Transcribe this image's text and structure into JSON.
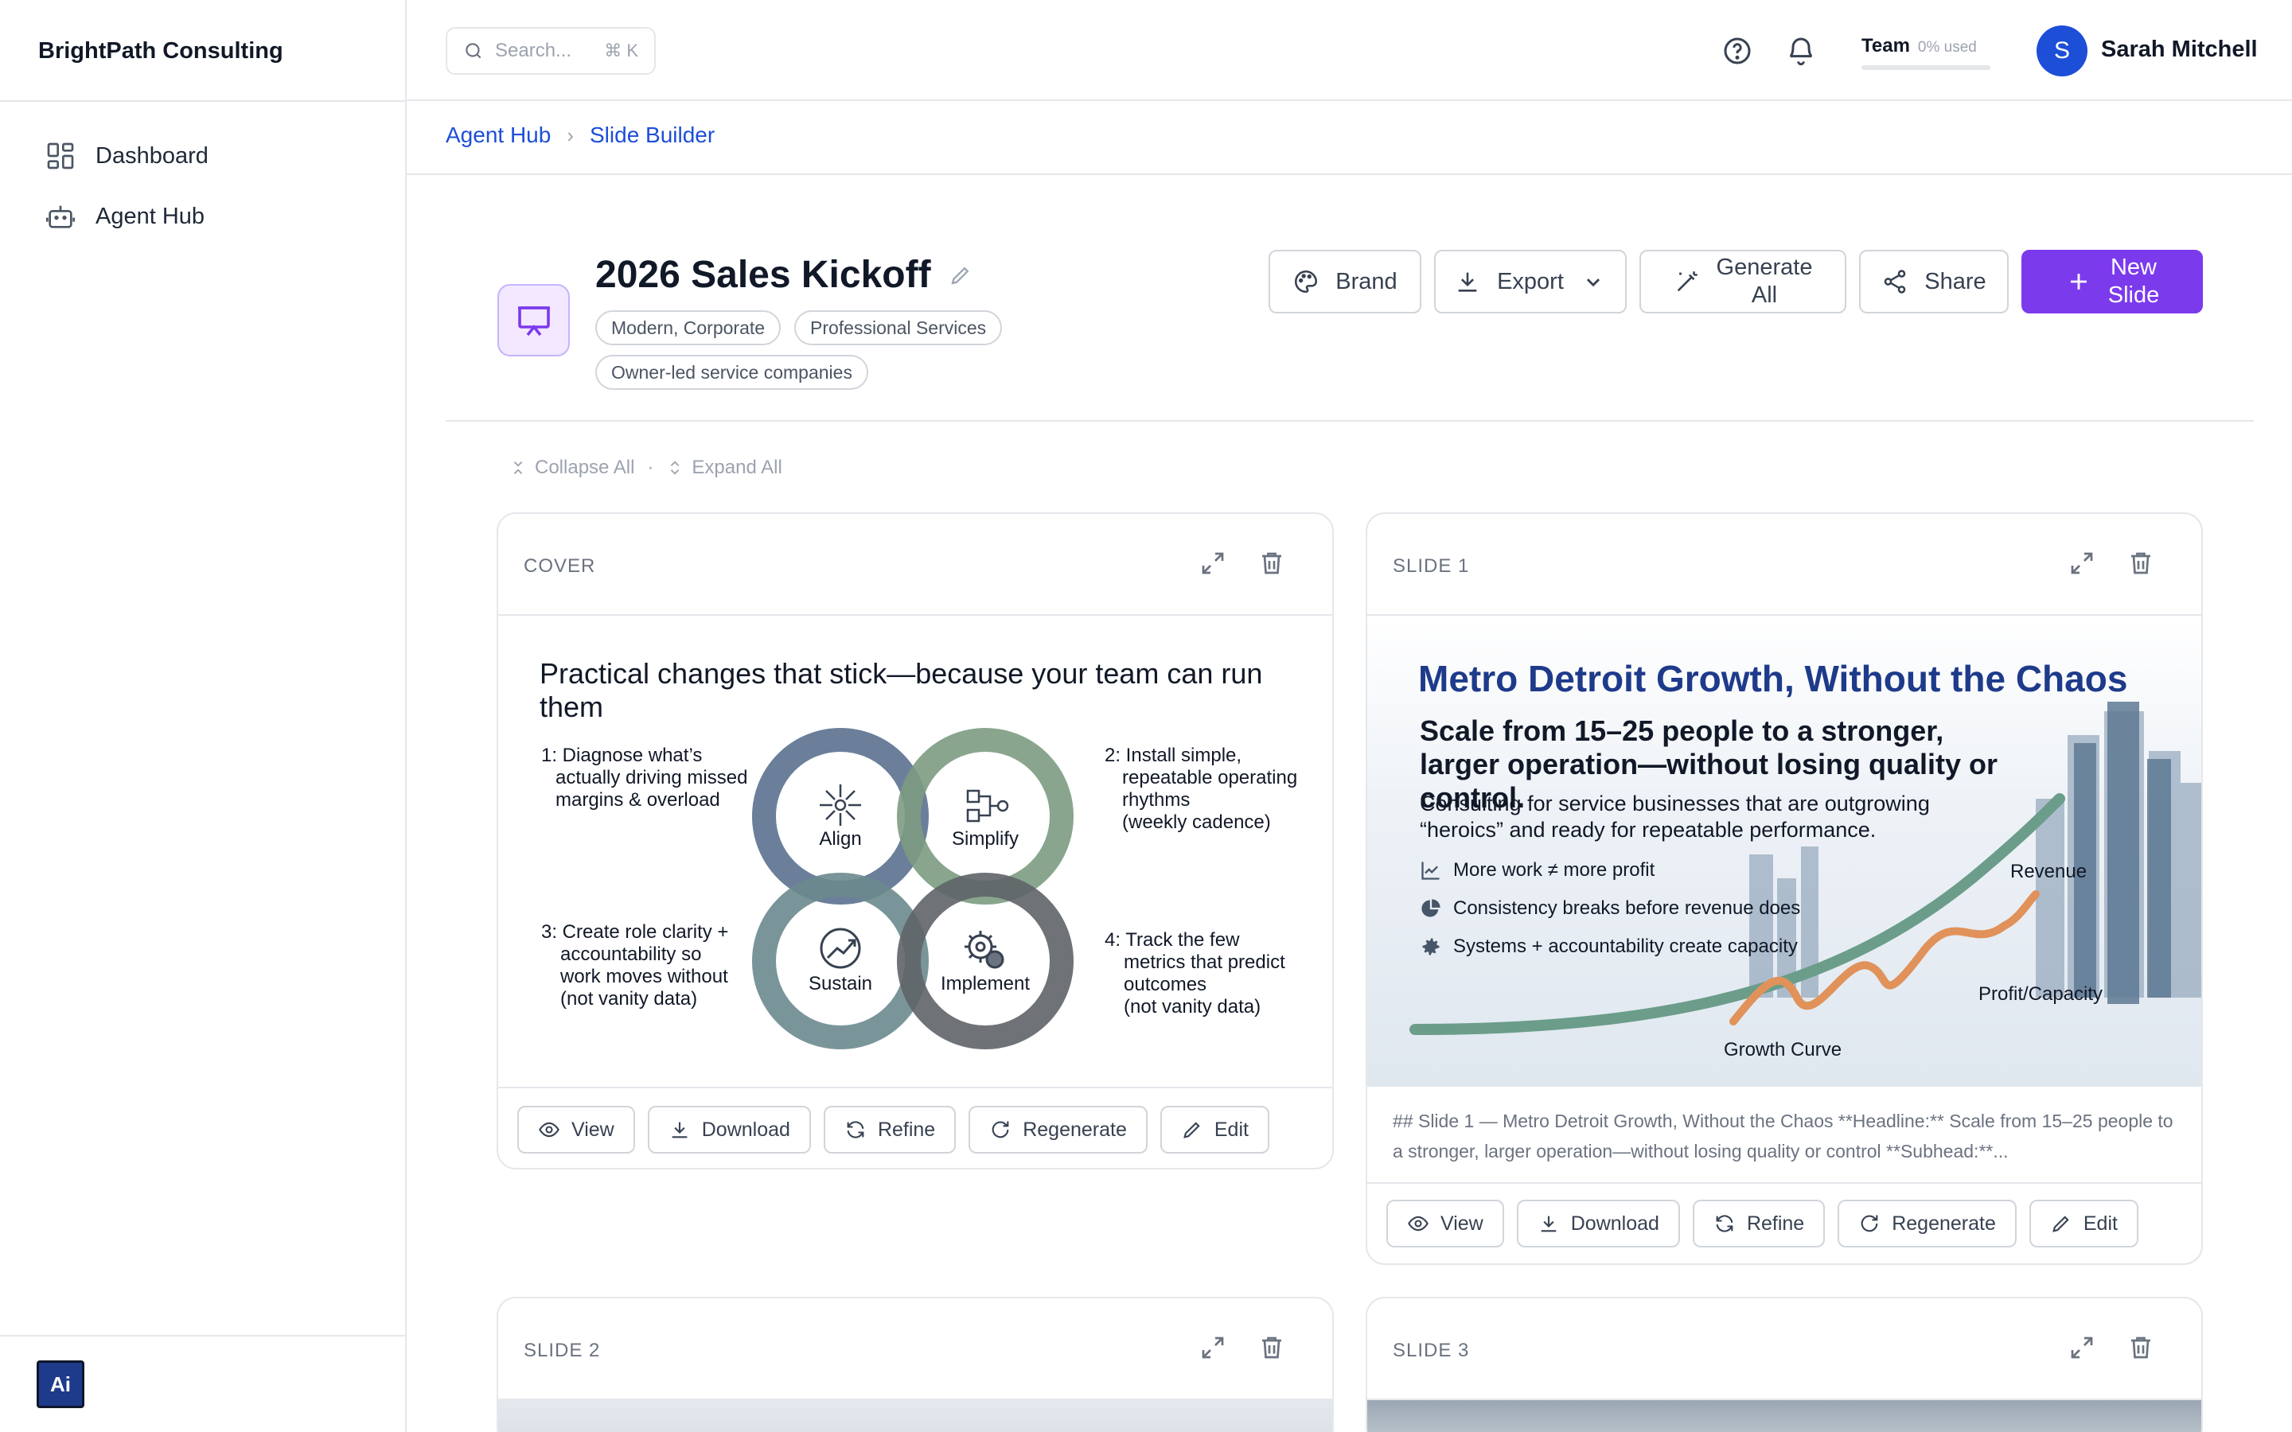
{
  "app": {
    "brand": "BrightPath Consulting"
  },
  "sidebar": {
    "items": [
      {
        "label": "Dashboard",
        "icon": "dashboard-icon"
      },
      {
        "label": "Agent Hub",
        "icon": "robot-icon"
      }
    ]
  },
  "topbar": {
    "search_placeholder": "Search...",
    "search_shortcut": "⌘ K",
    "team_label": "Team",
    "team_usage": "0% used",
    "team_usage_fraction": 0,
    "user_initial": "S",
    "user_name": "Sarah Mitchell"
  },
  "breadcrumb": {
    "items": [
      "Agent Hub",
      "Slide Builder"
    ]
  },
  "deck": {
    "title": "2026 Sales Kickoff",
    "tags": [
      "Modern, Corporate",
      "Professional Services",
      "Owner-led service companies"
    ]
  },
  "header_buttons": {
    "brand": "Brand",
    "export": "Export",
    "generate_line1": "Generate",
    "generate_line2": "All",
    "share": "Share",
    "new_line1": "New",
    "new_line2": "Slide"
  },
  "controls": {
    "collapse_all": "Collapse All",
    "separator": "·",
    "expand_all": "Expand All"
  },
  "card_actions": {
    "view": "View",
    "download": "Download",
    "refine": "Refine",
    "regenerate": "Regenerate",
    "edit": "Edit"
  },
  "cards": [
    {
      "label": "COVER",
      "slide": {
        "title": "Practical changes that stick—because your team can run them",
        "steps": [
          [
            "1: Diagnose what’s",
            "actually driving missed",
            "margins & overload"
          ],
          [
            "2: Install simple,",
            "repeatable operating",
            "rhythms",
            "(weekly cadence)"
          ],
          [
            "3: Create role clarity +",
            "accountability so",
            "work moves without",
            "(not vanity data)"
          ],
          [
            "4: Track the few",
            "metrics that predict",
            "outcomes",
            "(not vanity data)"
          ]
        ],
        "cycle": [
          "Align",
          "Simplify",
          "Sustain",
          "Implement"
        ]
      }
    },
    {
      "label": "SLIDE 1",
      "slide": {
        "title": "Metro Detroit Growth, Without the Chaos",
        "subtitle": "Scale from 15–25 people to a stronger, larger operation—without losing quality or control.",
        "body": "Consulting for service businesses that are outgrowing “heroics” and ready for repeatable performance.",
        "bullets": [
          {
            "text": "More work ≠ more profit",
            "icon": "trend-chart-icon"
          },
          {
            "text": "Consistency breaks before revenue does",
            "icon": "pie-chart-icon"
          },
          {
            "text": "Systems + accountability create capacity",
            "icon": "gear-icon"
          }
        ],
        "chart_labels": {
          "revenue": "Revenue",
          "profit": "Profit/Capacity",
          "curve": "Growth Curve"
        }
      },
      "description": "## Slide 1 — Metro Detroit Growth, Without the Chaos **Headline:** Scale from 15–25 people to a stronger, larger operation—without losing quality or control **Subhead:**..."
    },
    {
      "label": "SLIDE 2"
    },
    {
      "label": "SLIDE 3"
    }
  ]
}
